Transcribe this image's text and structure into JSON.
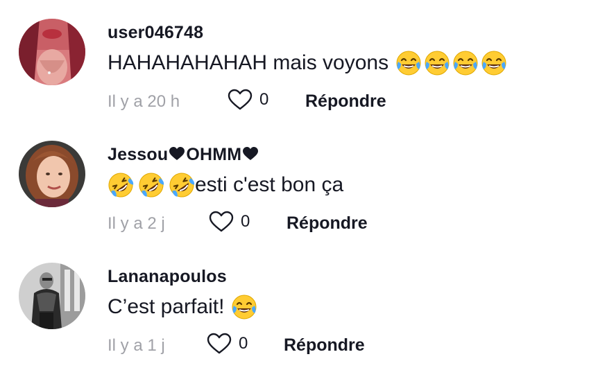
{
  "comments": [
    {
      "username": "user046748",
      "text": "HAHAHAHAHAH mais voyons",
      "emojis_after": [
        "tears-of-joy",
        "tears-of-joy",
        "tears-of-joy",
        "tears-of-joy"
      ],
      "time": "Il y a 20 h",
      "likes": "0",
      "reply_label": "Répondre"
    },
    {
      "username_part1": "Jessou",
      "username_part2": "OHMM",
      "name_icon": "black-heart",
      "emojis_before": [
        "rolling-on-floor-laughing",
        "rolling-on-floor-laughing",
        "rolling-on-floor-laughing"
      ],
      "text": "esti c'est bon ça",
      "time": "Il y a 2 j",
      "likes": "0",
      "reply_label": "Répondre"
    },
    {
      "username": "Lananapoulos",
      "text": "C’est parfait!",
      "emojis_after": [
        "tears-of-joy"
      ],
      "time": "Il y a 1 j",
      "likes": "0",
      "reply_label": "Répondre"
    }
  ],
  "colors": {
    "text": "#161823",
    "muted": "#a0a1a7",
    "heart_outline": "#161823"
  }
}
